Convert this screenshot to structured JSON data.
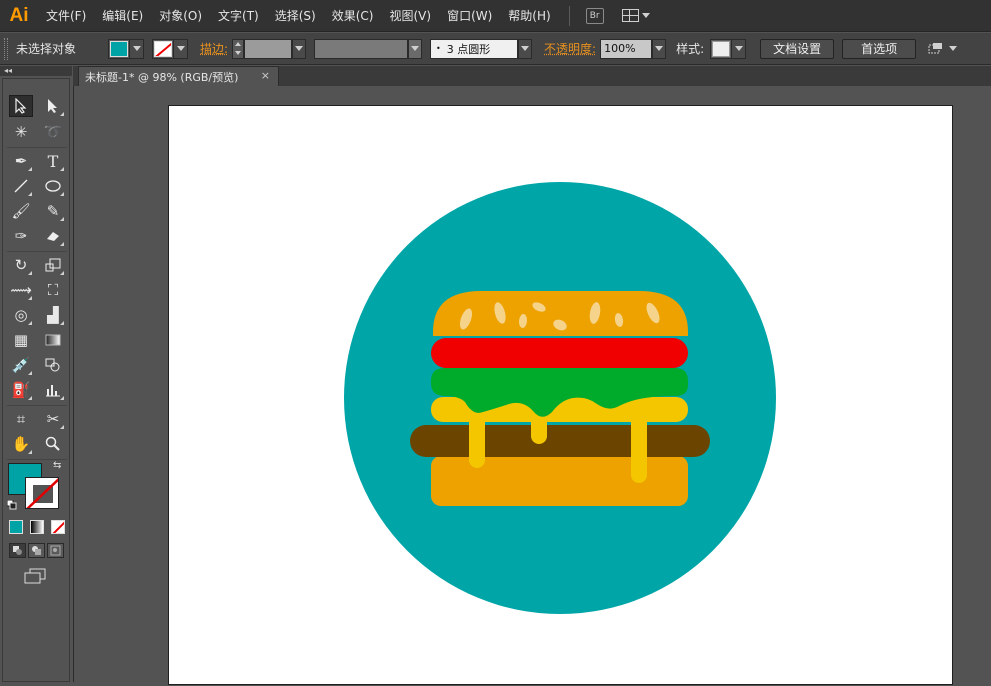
{
  "app": {
    "logo": "Ai"
  },
  "menu": {
    "items": [
      "文件(F)",
      "编辑(E)",
      "对象(O)",
      "文字(T)",
      "选择(S)",
      "效果(C)",
      "视图(V)",
      "窗口(W)",
      "帮助(H)"
    ],
    "bridge_label": "Br"
  },
  "control_bar": {
    "selection_status": "未选择对象",
    "fill_color": "#00a3a5",
    "stroke_label": "描边:",
    "brush_label": "3 点圆形",
    "opacity_label": "不透明度:",
    "opacity_value": "100%",
    "style_label": "样式:",
    "document_setup_button": "文档设置",
    "preferences_button": "首选项"
  },
  "document": {
    "tab_title": "未标题-1* @ 98% (RGB/预览)",
    "close_glyph": "×"
  },
  "tools": {
    "fill_color": "#00a3a5",
    "collapse_glyph": "◂◂"
  },
  "artwork": {
    "subject": "burger-icon",
    "colors": {
      "circle": "#00a5a7",
      "bun": "#eea200",
      "seeds": "#f5d38a",
      "tomato": "#f00000",
      "lettuce": "#00aa2a",
      "cheese": "#f3c600",
      "patty": "#6b4500"
    }
  }
}
